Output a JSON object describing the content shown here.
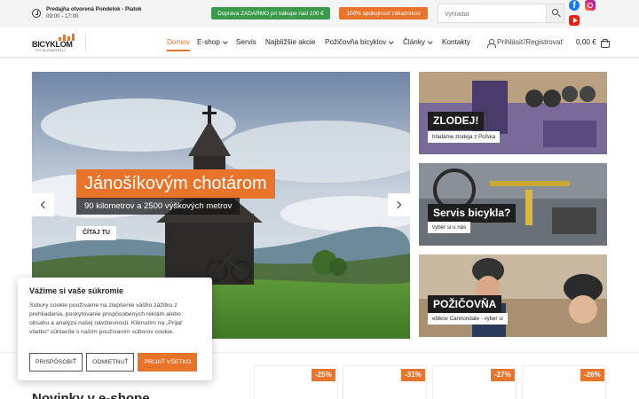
{
  "topbar": {
    "hours_title": "Predajňa otvorená Pondelok - Piatok",
    "hours_time": "09:00 - 17:00",
    "promo_shipping": "Doprava ZADARMO pri nákupe nad 100 €",
    "promo_satisfaction": "100% spokojnosť zákazníkov",
    "search_placeholder": "Vyhľadať",
    "social": {
      "facebook": "facebook-icon",
      "instagram": "instagram-icon",
      "youtube": "youtube-icon"
    }
  },
  "logo": {
    "text": "BICYKLOM",
    "sub": "PO SLOVENSKU"
  },
  "nav": {
    "items": [
      {
        "label": "Domov",
        "active": true
      },
      {
        "label": "E-shop",
        "dropdown": true
      },
      {
        "label": "Servis"
      },
      {
        "label": "Najbližšie akcie"
      },
      {
        "label": "Požičovňa bicyklov",
        "dropdown": true
      },
      {
        "label": "Články",
        "dropdown": true
      },
      {
        "label": "Kontakty"
      }
    ],
    "account": "Prihlásiť/Registrovať",
    "cart_total": "0,00 €"
  },
  "hero": {
    "title": "Jánošíkovým chotárom",
    "subtitle": "90 kilometrov a 2500 výškových metrov",
    "cta": "ČÍTAJ TU"
  },
  "cards": [
    {
      "title": "ZLODEJ!",
      "caption": "hľadáme zlodeja z Poľska"
    },
    {
      "title": "Servis bicykla?",
      "caption": "vyber si u nás"
    },
    {
      "title": "POŽIČOVŇA",
      "caption": "ebikov Cannondale - vyber si"
    }
  ],
  "cookie": {
    "title": "Vážime si vaše súkromie",
    "text": "Súbory cookie používame na zlepšenie vášho zážitku z prehliadania, poskytovanie prispôsobených reklám alebo obsahu a analýzu našej návštevnosti. Kliknutím na „Prijať všetko“ súhlasíte s naším používaním súborov cookie.",
    "customize": "PRISPÔSOBIŤ",
    "reject": "ODMIETNUŤ",
    "accept": "PRIJAŤ VŠETKO"
  },
  "products": {
    "title": "Novinky v e-shope",
    "discounts": [
      "-25%",
      "-31%",
      "-27%",
      "-26%"
    ]
  },
  "colors": {
    "accent": "#e8742c",
    "green": "#3a9a4a",
    "dark": "#1e1e1e"
  }
}
